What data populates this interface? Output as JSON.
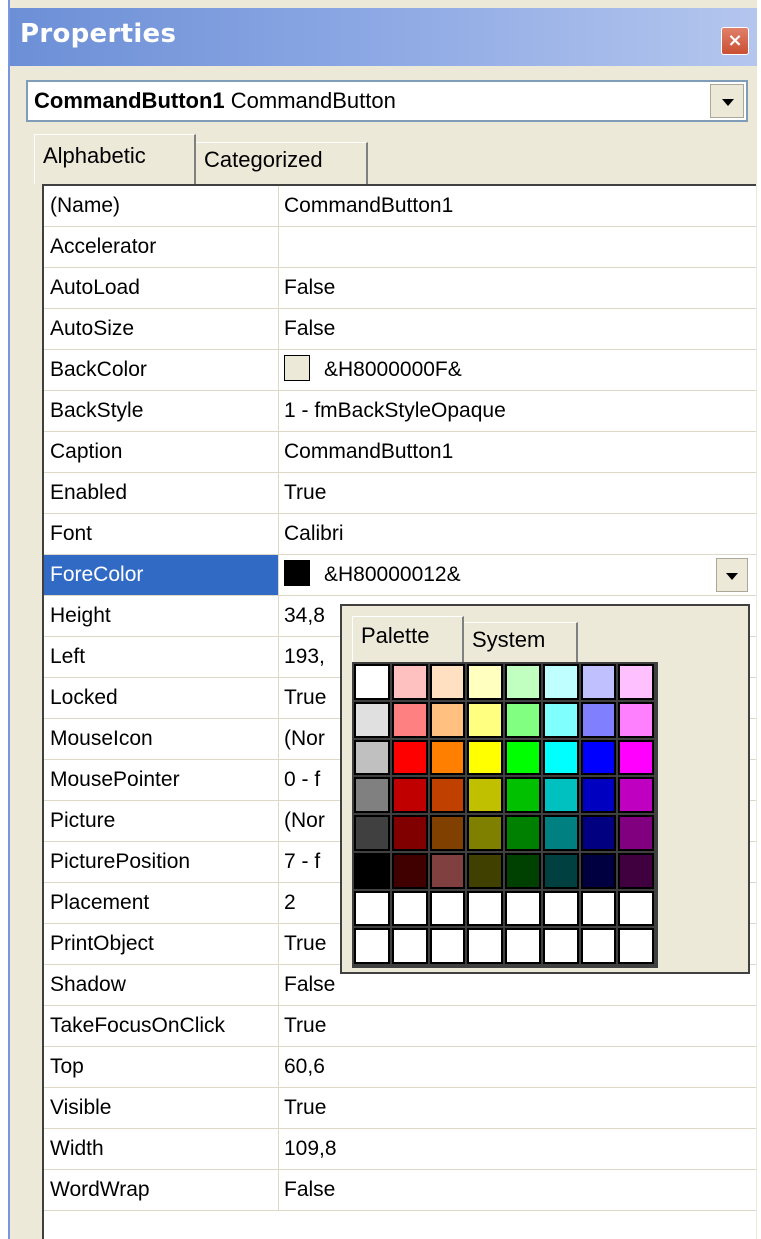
{
  "window": {
    "title": "Properties",
    "close_glyph": "×"
  },
  "object_selector": {
    "name": "CommandButton1",
    "type": "CommandButton"
  },
  "tabs": [
    {
      "label": "Alphabetic"
    },
    {
      "label": "Categorized"
    }
  ],
  "selected_property": "ForeColor",
  "properties": [
    {
      "name": "(Name)",
      "value": "CommandButton1"
    },
    {
      "name": "Accelerator",
      "value": ""
    },
    {
      "name": "AutoLoad",
      "value": "False"
    },
    {
      "name": "AutoSize",
      "value": "False"
    },
    {
      "name": "BackColor",
      "value": "&H8000000F&",
      "swatch": "#ece9d8"
    },
    {
      "name": "BackStyle",
      "value": "1 - fmBackStyleOpaque"
    },
    {
      "name": "Caption",
      "value": "CommandButton1"
    },
    {
      "name": "Enabled",
      "value": "True"
    },
    {
      "name": "Font",
      "value": "Calibri"
    },
    {
      "name": "ForeColor",
      "value": "&H80000012&",
      "swatch": "#000000"
    },
    {
      "name": "Height",
      "value": "34,8"
    },
    {
      "name": "Left",
      "value": "193,"
    },
    {
      "name": "Locked",
      "value": "True"
    },
    {
      "name": "MouseIcon",
      "value": "(Nor"
    },
    {
      "name": "MousePointer",
      "value": "0 - f"
    },
    {
      "name": "Picture",
      "value": "(Nor"
    },
    {
      "name": "PicturePosition",
      "value": "7 - f"
    },
    {
      "name": "Placement",
      "value": "2"
    },
    {
      "name": "PrintObject",
      "value": "True"
    },
    {
      "name": "Shadow",
      "value": "False"
    },
    {
      "name": "TakeFocusOnClick",
      "value": "True"
    },
    {
      "name": "Top",
      "value": "60,6"
    },
    {
      "name": "Visible",
      "value": "True"
    },
    {
      "name": "Width",
      "value": "109,8"
    },
    {
      "name": "WordWrap",
      "value": "False"
    }
  ],
  "color_popup": {
    "tabs": [
      {
        "label": "Palette"
      },
      {
        "label": "System"
      }
    ],
    "palette": [
      [
        "#ffffff",
        "#ffc0c0",
        "#ffe0c0",
        "#ffffc0",
        "#c0ffc0",
        "#c0ffff",
        "#c0c0ff",
        "#ffc0ff"
      ],
      [
        "#e0e0e0",
        "#ff8080",
        "#ffc080",
        "#ffff80",
        "#80ff80",
        "#80ffff",
        "#8080ff",
        "#ff80ff"
      ],
      [
        "#c0c0c0",
        "#ff0000",
        "#ff8000",
        "#ffff00",
        "#00ff00",
        "#00ffff",
        "#0000ff",
        "#ff00ff"
      ],
      [
        "#808080",
        "#c00000",
        "#c04000",
        "#c0c000",
        "#00c000",
        "#00c0c0",
        "#0000c0",
        "#c000c0"
      ],
      [
        "#404040",
        "#800000",
        "#804000",
        "#808000",
        "#008000",
        "#008080",
        "#000080",
        "#800080"
      ],
      [
        "#000000",
        "#400000",
        "#804040",
        "#404000",
        "#004000",
        "#004040",
        "#000040",
        "#400040"
      ],
      [
        "#ffffff",
        "#ffffff",
        "#ffffff",
        "#ffffff",
        "#ffffff",
        "#ffffff",
        "#ffffff",
        "#ffffff"
      ],
      [
        "#ffffff",
        "#ffffff",
        "#ffffff",
        "#ffffff",
        "#ffffff",
        "#ffffff",
        "#ffffff",
        "#ffffff"
      ]
    ]
  }
}
